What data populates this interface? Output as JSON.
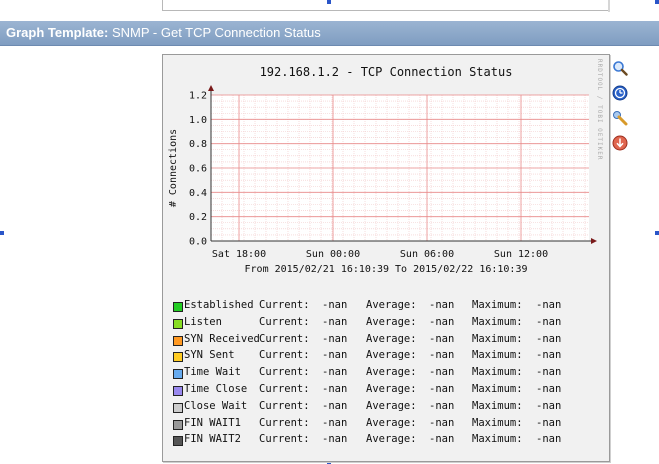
{
  "header": {
    "label": "Graph Template:",
    "value": "SNMP - Get TCP Connection Status"
  },
  "graph": {
    "watermark": "RRDTOOL / TOBI OETIKER",
    "range_text": "From 2015/02/21 16:10:39 To 2015/02/22 16:10:39"
  },
  "chart_data": {
    "type": "line",
    "title": "192.168.1.2 - TCP Connection Status",
    "ylabel": "# Connections",
    "ylim": [
      0,
      1.2
    ],
    "yticks": [
      "0.0",
      "0.2",
      "0.4",
      "0.6",
      "0.8",
      "1.0",
      "1.2"
    ],
    "xticks": [
      "Sat 18:00",
      "Sun 00:00",
      "Sun 06:00",
      "Sun 12:00"
    ],
    "grid": true,
    "series": [
      {
        "name": "Established",
        "color": "#22cc22",
        "values": [],
        "current": "-nan",
        "average": "-nan",
        "maximum": "-nan"
      },
      {
        "name": "Listen",
        "color": "#88dd22",
        "values": [],
        "current": "-nan",
        "average": "-nan",
        "maximum": "-nan"
      },
      {
        "name": "SYN Received",
        "color": "#ff9922",
        "values": [],
        "current": "-nan",
        "average": "-nan",
        "maximum": "-nan"
      },
      {
        "name": "SYN Sent",
        "color": "#ffcc22",
        "values": [],
        "current": "-nan",
        "average": "-nan",
        "maximum": "-nan"
      },
      {
        "name": "Time Wait",
        "color": "#66aaee",
        "values": [],
        "current": "-nan",
        "average": "-nan",
        "maximum": "-nan"
      },
      {
        "name": "Time Close",
        "color": "#9988ee",
        "values": [],
        "current": "-nan",
        "average": "-nan",
        "maximum": "-nan"
      },
      {
        "name": "Close Wait",
        "color": "#cccccc",
        "values": [],
        "current": "-nan",
        "average": "-nan",
        "maximum": "-nan"
      },
      {
        "name": "FIN WAIT1",
        "color": "#999999",
        "values": [],
        "current": "-nan",
        "average": "-nan",
        "maximum": "-nan"
      },
      {
        "name": "FIN WAIT2",
        "color": "#555555",
        "values": [],
        "current": "-nan",
        "average": "-nan",
        "maximum": "-nan"
      }
    ],
    "legend_labels": {
      "current": "Current:",
      "average": "Average:",
      "maximum": "Maximum:"
    }
  },
  "icons": [
    {
      "name": "zoom-graph-icon",
      "color": "#3a78d4"
    },
    {
      "name": "time-span-icon",
      "color": "#2a62c9"
    },
    {
      "name": "graph-properties-icon",
      "color": "#d89a2a"
    },
    {
      "name": "export-csv-icon",
      "color": "#d24a3a"
    }
  ]
}
